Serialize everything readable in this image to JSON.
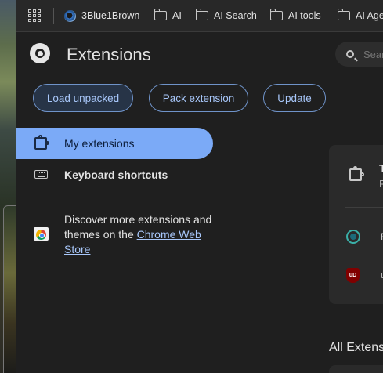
{
  "bookmarks": {
    "items": [
      {
        "label": "3Blue1Brown",
        "icon": "3blue1brown-favicon"
      },
      {
        "label": "AI",
        "icon": "folder-icon"
      },
      {
        "label": "AI Search",
        "icon": "folder-icon"
      },
      {
        "label": "AI tools",
        "icon": "folder-icon"
      },
      {
        "label": "AI Age",
        "icon": "folder-icon"
      }
    ]
  },
  "header": {
    "title": "Extensions",
    "search_placeholder": "Search"
  },
  "toolbar": {
    "load_label": "Load unpacked",
    "pack_label": "Pack extension",
    "update_label": "Update"
  },
  "sidebar": {
    "items": [
      {
        "label": "My extensions",
        "icon": "puzzle-icon",
        "selected": true
      },
      {
        "label": "Keyboard shortcuts",
        "icon": "keyboard-icon",
        "selected": false
      }
    ],
    "discover_text": "Discover more extensions and themes on the ",
    "webstore_link": "Chrome Web Store"
  },
  "main": {
    "card_title": "T",
    "card_sub": "P",
    "ext1_label": "F",
    "ext2_label": "u",
    "ext2_icon_text": "uD",
    "all_extensions_heading": "All Extens"
  },
  "colors": {
    "selected_nav": "#7baaf7",
    "accent_text": "#a8c7fa",
    "background": "#1f1f1f"
  }
}
